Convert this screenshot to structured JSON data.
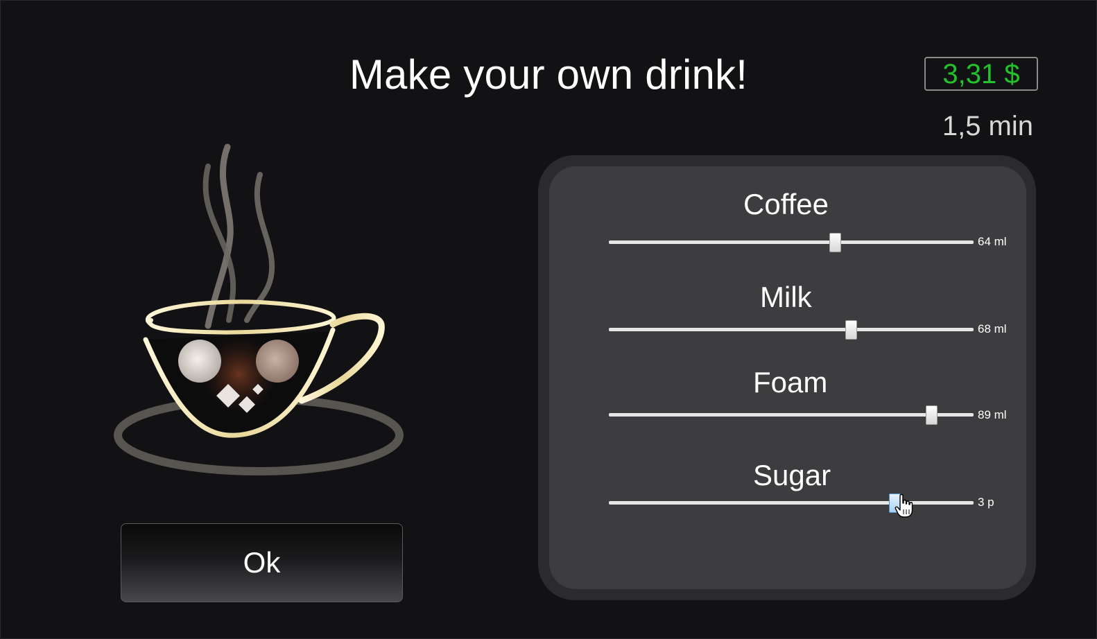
{
  "title": "Make your own drink!",
  "price": "3,31 $",
  "time": "1,5 min",
  "ok_button": "Ok",
  "colors": {
    "background": "#121214",
    "price_text": "#22c32a",
    "panel_outer": "#2b2b2e",
    "panel_inner": "#3d3d40",
    "text": "#ffffff"
  },
  "sliders": [
    {
      "label": "Coffee",
      "value_text": "64 ml",
      "fraction": 0.62
    },
    {
      "label": "Milk",
      "value_text": "68 ml",
      "fraction": 0.665
    },
    {
      "label": "Foam",
      "value_text": "89 ml",
      "fraction": 0.885
    },
    {
      "label": "Sugar",
      "value_text": "3 p",
      "fraction": 0.785
    }
  ],
  "icons": {
    "cup": "coffee-cup-icon",
    "cursor": "hand-pointer-icon"
  }
}
